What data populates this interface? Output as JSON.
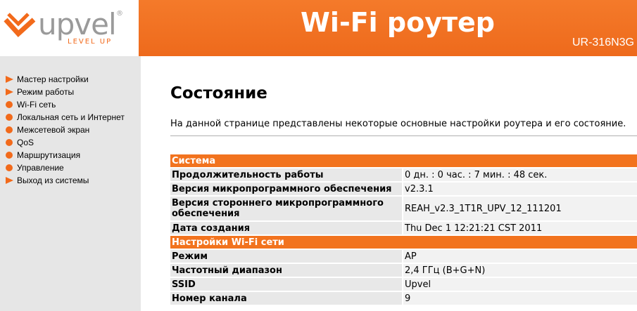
{
  "header": {
    "logo_text": "upvel",
    "logo_sub": "LEVEL UP",
    "title": "Wi-Fi роутер",
    "model": "UR-316N3G"
  },
  "sidebar": {
    "items": [
      {
        "label": "Мастер настройки",
        "icon": "triangle-icon"
      },
      {
        "label": "Режим работы",
        "icon": "triangle-icon"
      },
      {
        "label": "Wi-Fi сеть",
        "icon": "dot-icon"
      },
      {
        "label": "Локальная сеть и Интернет",
        "icon": "dot-icon"
      },
      {
        "label": "Межсетевой экран",
        "icon": "dot-icon"
      },
      {
        "label": "QoS",
        "icon": "dot-icon"
      },
      {
        "label": "Маршрутизация",
        "icon": "dot-icon"
      },
      {
        "label": "Управление",
        "icon": "dot-icon"
      },
      {
        "label": "Выход из системы",
        "icon": "triangle-icon"
      }
    ]
  },
  "main": {
    "title": "Состояние",
    "description": "На данной странице представлены некоторые основные настройки роутера и его состояние."
  },
  "table": {
    "section_system": "Система",
    "uptime_label": "Продолжительность работы",
    "uptime_value": "0 дн. : 0 час. : 7 мин. : 48 сек.",
    "fw_label": "Версия микропрограммного обеспечения",
    "fw_value": "v2.3.1",
    "thirdfw_label": "Версия стороннего микропрограммного обеспечения",
    "thirdfw_value": "REAH_v2.3_1T1R_UPV_12_111201",
    "build_label": "Дата создания",
    "build_value": "Thu Dec 1 12:21:21 CST 2011",
    "section_wifi": "Настройки Wi-Fi сети",
    "mode_label": "Режим",
    "mode_value": "AP",
    "band_label": "Частотный диапазон",
    "band_value": "2,4 ГГц (B+G+N)",
    "ssid_label": "SSID",
    "ssid_value": "Upvel",
    "channel_label": "Номер канала",
    "channel_value": "9"
  },
  "colors": {
    "accent": "#f26a1b",
    "sidebar_bg": "#e6e6e6"
  }
}
